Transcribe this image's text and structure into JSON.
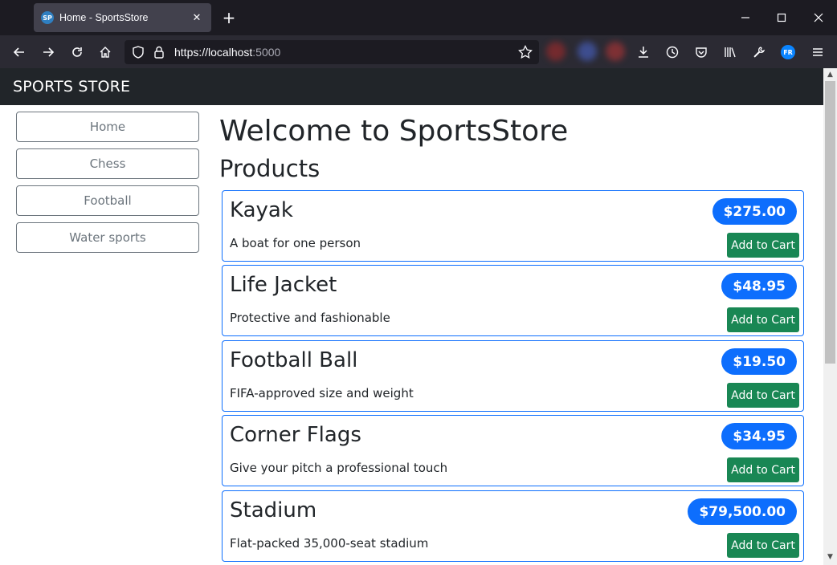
{
  "browser": {
    "tab_title": "Home - SportsStore",
    "favicon_text": "SP",
    "url_host": "https://localhost",
    "url_port": ":5000",
    "profile_initials": "FR"
  },
  "site": {
    "brand": "SPORTS STORE",
    "categories": [
      "Home",
      "Chess",
      "Football",
      "Water sports"
    ],
    "welcome": "Welcome to SportsStore",
    "products_heading": "Products",
    "add_to_cart_label": "Add to Cart"
  },
  "products": [
    {
      "name": "Kayak",
      "description": "A boat for one person",
      "price": "$275.00"
    },
    {
      "name": "Life Jacket",
      "description": "Protective and fashionable",
      "price": "$48.95"
    },
    {
      "name": "Football Ball",
      "description": "FIFA-approved size and weight",
      "price": "$19.50"
    },
    {
      "name": "Corner Flags",
      "description": "Give your pitch a professional touch",
      "price": "$34.95"
    },
    {
      "name": "Stadium",
      "description": "Flat-packed 35,000-seat stadium",
      "price": "$79,500.00"
    }
  ],
  "colors": {
    "header_bg": "#212529",
    "primary": "#0d6efd",
    "success": "#198754",
    "secondary": "#6c757d"
  }
}
